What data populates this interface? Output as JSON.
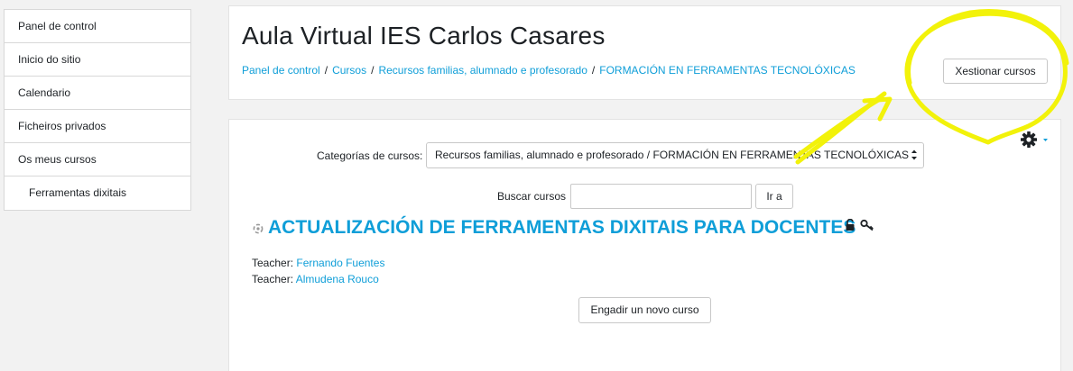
{
  "sidebar": {
    "items": [
      {
        "label": "Panel de control"
      },
      {
        "label": "Inicio do sitio"
      },
      {
        "label": "Calendario"
      },
      {
        "label": "Ficheiros privados"
      },
      {
        "label": "Os meus cursos"
      },
      {
        "label": "Ferramentas dixitais"
      }
    ]
  },
  "header": {
    "title": "Aula Virtual IES Carlos Casares",
    "breadcrumb": [
      {
        "label": "Panel de control"
      },
      {
        "label": "Cursos"
      },
      {
        "label": "Recursos familias, alumnado e profesorado"
      },
      {
        "label": "FORMACIÓN EN FERRAMENTAS TECNOLÓXICAS"
      }
    ],
    "breadcrumb_separator": "/",
    "manage_button": "Xestionar cursos"
  },
  "main": {
    "settings_icon": "gear-icon",
    "category_label": "Categorías de cursos:",
    "category_value": "Recursos familias, alumnado e profesorado / FORMACIÓN EN FERRAMENTAS TECNOLÓXICAS",
    "search_label": "Buscar cursos",
    "search_value": "",
    "go_button": "Ir a",
    "course": {
      "title": "ACTUALIZACIÓN DE FERRAMENTAS DIXITAIS PARA DOCENTES",
      "icons": [
        "unlock-icon",
        "key-icon"
      ],
      "teachers": [
        {
          "role": "Teacher:",
          "name": "Fernando Fuentes"
        },
        {
          "role": "Teacher:",
          "name": "Almudena Rouco"
        }
      ]
    },
    "add_button": "Engadir un novo curso"
  },
  "colors": {
    "link": "#0f9ed8",
    "annotation": "#f2f20a",
    "background": "#f2f2f2"
  }
}
